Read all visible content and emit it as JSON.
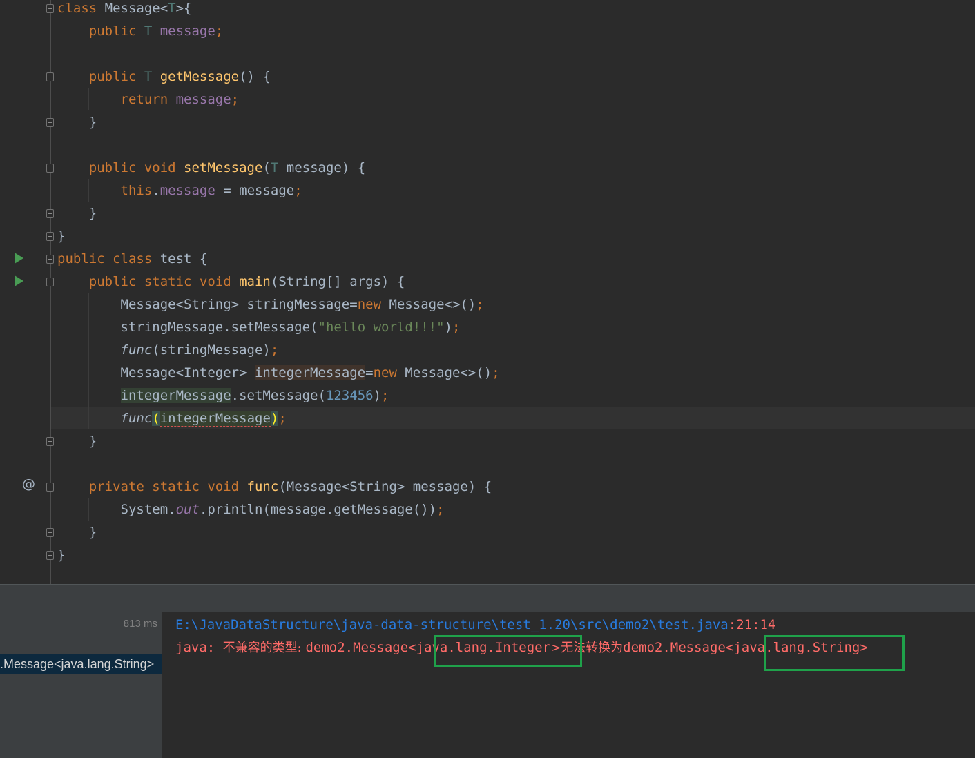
{
  "editor": {
    "lines": [
      {
        "tokens": [
          {
            "t": "class ",
            "c": "kw"
          },
          {
            "t": "Message<"
          },
          {
            "t": "T",
            "c": "tp"
          },
          {
            "t": ">{"
          }
        ]
      },
      {
        "tokens": [
          {
            "t": "    "
          },
          {
            "t": "public ",
            "c": "kw"
          },
          {
            "t": "T ",
            "c": "tp"
          },
          {
            "t": "message",
            "c": "fd"
          },
          {
            "t": ";",
            "c": "kw"
          }
        ]
      },
      {
        "tokens": []
      },
      {
        "tokens": [
          {
            "t": "    "
          },
          {
            "t": "public ",
            "c": "kw"
          },
          {
            "t": "T ",
            "c": "tp"
          },
          {
            "t": "getMessage",
            "c": "fn"
          },
          {
            "t": "() {"
          }
        ]
      },
      {
        "tokens": [
          {
            "t": "        "
          },
          {
            "t": "return ",
            "c": "kw"
          },
          {
            "t": "message",
            "c": "fd"
          },
          {
            "t": ";",
            "c": "kw"
          }
        ]
      },
      {
        "tokens": [
          {
            "t": "    }"
          }
        ]
      },
      {
        "tokens": []
      },
      {
        "tokens": [
          {
            "t": "    "
          },
          {
            "t": "public void ",
            "c": "kw"
          },
          {
            "t": "setMessage",
            "c": "fn"
          },
          {
            "t": "("
          },
          {
            "t": "T ",
            "c": "tp"
          },
          {
            "t": "message) {"
          }
        ]
      },
      {
        "tokens": [
          {
            "t": "        "
          },
          {
            "t": "this",
            "c": "kw"
          },
          {
            "t": "."
          },
          {
            "t": "message ",
            "c": "fd"
          },
          {
            "t": "= message"
          },
          {
            "t": ";",
            "c": "kw"
          }
        ]
      },
      {
        "tokens": [
          {
            "t": "    }"
          }
        ]
      },
      {
        "tokens": [
          {
            "t": "}"
          }
        ]
      },
      {
        "tokens": [
          {
            "t": "public class ",
            "c": "kw"
          },
          {
            "t": "test {"
          }
        ]
      },
      {
        "tokens": [
          {
            "t": "    "
          },
          {
            "t": "public static void ",
            "c": "kw"
          },
          {
            "t": "main",
            "c": "fn"
          },
          {
            "t": "(String[] args) {"
          }
        ]
      },
      {
        "tokens": [
          {
            "t": "        Message<String> stringMessage="
          },
          {
            "t": "new ",
            "c": "kw"
          },
          {
            "t": "Message<>()"
          },
          {
            "t": ";",
            "c": "kw"
          }
        ]
      },
      {
        "tokens": [
          {
            "t": "        stringMessage.setMessage("
          },
          {
            "t": "\"hello world!!!\"",
            "c": "st"
          },
          {
            "t": ")"
          },
          {
            "t": ";",
            "c": "kw"
          }
        ]
      },
      {
        "tokens": [
          {
            "t": "        "
          },
          {
            "t": "func",
            "c": "it"
          },
          {
            "t": "(stringMessage)"
          },
          {
            "t": ";",
            "c": "kw"
          }
        ]
      },
      {
        "tokens": [
          {
            "t": "        Message<Integer> "
          },
          {
            "t": "integerMessage",
            "c": "hl-write"
          },
          {
            "t": "="
          },
          {
            "t": "new ",
            "c": "kw"
          },
          {
            "t": "Message<>()"
          },
          {
            "t": ";",
            "c": "kw"
          }
        ]
      },
      {
        "tokens": [
          {
            "t": "        "
          },
          {
            "t": "integerMessage",
            "c": "hl-read"
          },
          {
            "t": ".setMessage("
          },
          {
            "t": "123456",
            "c": "nm"
          },
          {
            "t": ")"
          },
          {
            "t": ";",
            "c": "kw"
          }
        ]
      },
      {
        "tokens": [
          {
            "t": "        "
          },
          {
            "t": "func",
            "c": "it"
          },
          {
            "t": "(",
            "c": "brace-match"
          },
          {
            "t": "integerMessage",
            "c": "err-arg"
          },
          {
            "t": ")",
            "c": "brace-match"
          },
          {
            "t": ";",
            "c": "kw"
          }
        ]
      },
      {
        "tokens": [
          {
            "t": "    }"
          }
        ]
      },
      {
        "tokens": []
      },
      {
        "tokens": [
          {
            "t": "    "
          },
          {
            "t": "private static void ",
            "c": "kw"
          },
          {
            "t": "func",
            "c": "fn"
          },
          {
            "t": "(Message<String> message) {"
          }
        ]
      },
      {
        "tokens": [
          {
            "t": "        System."
          },
          {
            "t": "out",
            "c": "fd it"
          },
          {
            "t": ".println(message.getMessage())"
          },
          {
            "t": ";",
            "c": "kw"
          }
        ]
      },
      {
        "tokens": [
          {
            "t": "    }"
          }
        ]
      },
      {
        "tokens": [
          {
            "t": "}"
          }
        ]
      }
    ],
    "gutter_marks": {
      "override_symbol": "@"
    }
  },
  "build": {
    "timing": "813 ms",
    "selected_node": ".Message<java.lang.String>"
  },
  "console": {
    "file_link": "E:\\JavaDataStructure\\java-data-structure\\test_1.20\\src\\demo2\\test.java",
    "position": ":21:14",
    "error_prefix": "java: ",
    "error_cn_1": "不兼容的类型: ",
    "error_type_a_pre": "demo2.Message<",
    "error_type_a": "java.lang.Integer",
    "error_cn_2": ">无法转换为",
    "error_type_b_pre": "demo2.Message<",
    "error_type_b": "java.lang.String",
    "error_suffix": ">",
    "colors": {
      "error": "#ff6b68",
      "link": "#287bde",
      "highlight_box": "#1fa14a"
    }
  }
}
